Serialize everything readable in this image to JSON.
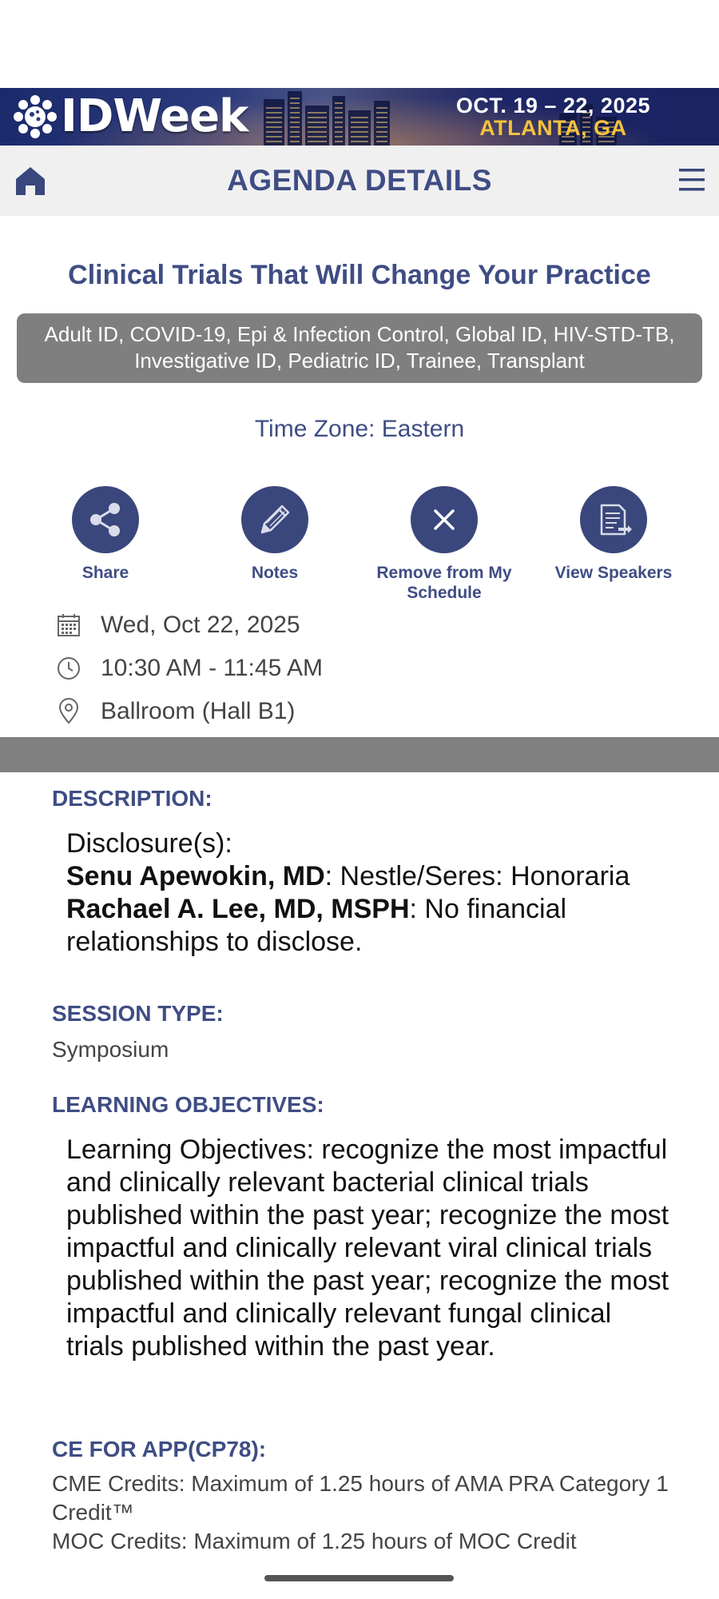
{
  "banner": {
    "logo_text": "IDWeek",
    "dates": "OCT. 19 – 22, 2025",
    "location": "ATLANTA, GA"
  },
  "nav": {
    "title": "AGENDA DETAILS",
    "home_icon": "home-icon",
    "menu_icon": "hamburger-menu-icon"
  },
  "session": {
    "title": "Clinical Trials That Will Change Your Practice",
    "tracks": "Adult ID, COVID-19, Epi & Infection Control, Global ID, HIV-STD-TB, Investigative ID, Pediatric ID, Trainee, Transplant",
    "time_zone": "Time Zone: Eastern",
    "date": "Wed, Oct 22, 2025",
    "time": "10:30 AM - 11:45 AM",
    "location": "Ballroom (Hall B1)"
  },
  "actions": [
    {
      "label": "Share",
      "icon": "share-icon"
    },
    {
      "label": "Notes",
      "icon": "pencil-icon"
    },
    {
      "label": "Remove from My Schedule",
      "icon": "close-icon"
    },
    {
      "label": "View Speakers",
      "icon": "document-icon"
    }
  ],
  "description": {
    "heading": "DESCRIPTION:",
    "intro": "Disclosure(s):",
    "speaker1_name": "Senu Apewokin, MD",
    "speaker1_disclosure": ": Nestle/Seres: Honoraria",
    "speaker2_name": "Rachael A. Lee, MD, MSPH",
    "speaker2_disclosure": ": No financial relationships to disclose."
  },
  "session_type": {
    "heading": "SESSION TYPE:",
    "value": "Symposium"
  },
  "learning_objectives": {
    "heading": "LEARNING OBJECTIVES:",
    "text": "Learning Objectives: recognize the most impactful and clinically relevant bacterial clinical trials published within the past year; recognize the most impactful and clinically relevant viral clinical trials published within the past year; recognize the most impactful and clinically relevant fungal clinical trials published within the past year."
  },
  "ce": {
    "heading": "CE FOR APP(CP78):",
    "cme": "CME Credits: Maximum of 1.25 hours of AMA PRA Category 1 Credit™",
    "moc": "MOC Credits: Maximum of 1.25 hours of MOC Credit"
  },
  "colors": {
    "brand_blue": "#3f4d84",
    "button_blue": "#3a477c",
    "gray_band": "#808080",
    "banner_gold": "#f5c23b"
  }
}
